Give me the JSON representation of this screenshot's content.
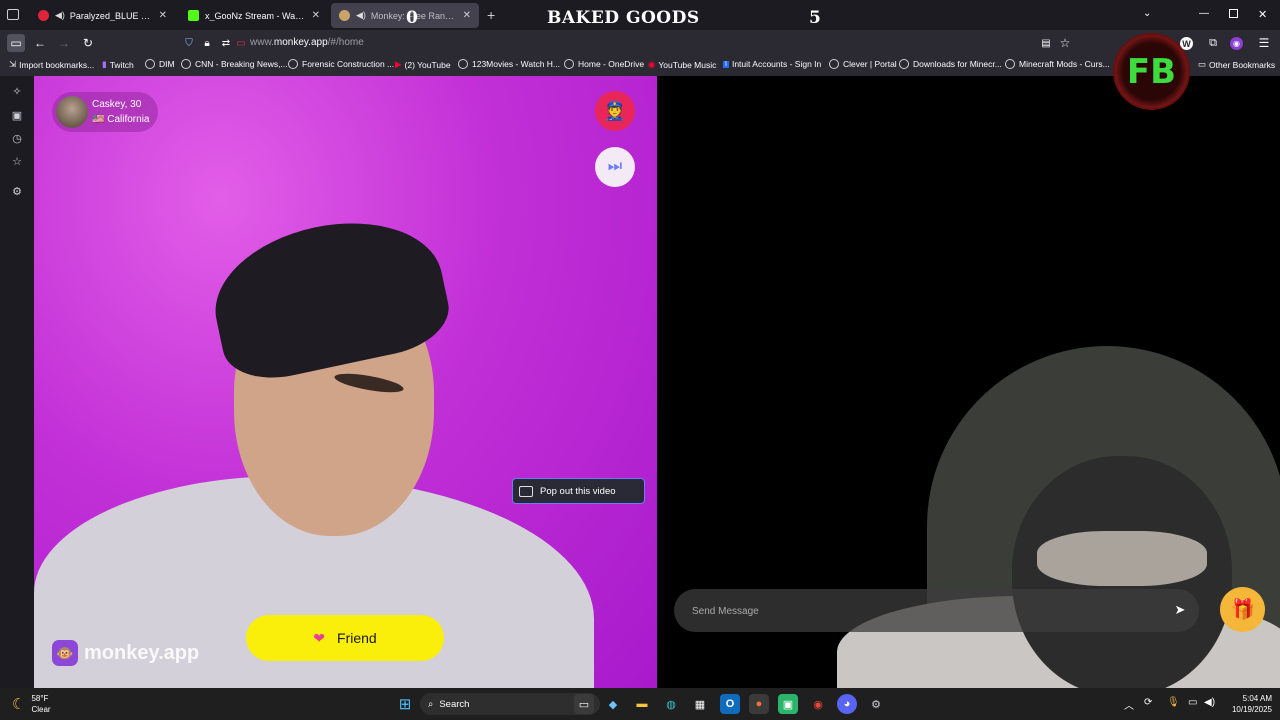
{
  "tabs": [
    {
      "title": "Paralyzed_BLUE - Explore y",
      "favicon_color": "#e0243a",
      "sound": true
    },
    {
      "title": "x_GooNz Stream - Watch Live o",
      "favicon_color": "#53fc18",
      "sound": false
    },
    {
      "title": "Monkey: Free Random Vide",
      "favicon_color": "#c9a46a",
      "sound": true,
      "active": true
    }
  ],
  "overlay": {
    "title": "BAKED GOODS",
    "left_number": "0",
    "right_number": "5"
  },
  "nav": {
    "url_prefix": "www.",
    "url_domain": "monkey.app",
    "url_path": "/#/home"
  },
  "bookmarks": [
    "Import bookmarks...",
    "Twitch",
    "DIM",
    "CNN - Breaking News,...",
    "Forensic Construction ...",
    "(2) YouTube",
    "123Movies - Watch H...",
    "Home - OneDrive",
    "YouTube Music",
    "Intuit Accounts - Sign In",
    "Clever | Portal",
    "Downloads for Minecr...",
    "Minecraft Mods - Curs...",
    "Other Bookmarks"
  ],
  "peer": {
    "name": "Caskey, 30",
    "location": "California",
    "flag": "🇺🇸"
  },
  "popout_label": "Pop out this video",
  "friend_label": "Friend",
  "brand_label": "monkey.app",
  "message": {
    "placeholder": "Send Message"
  },
  "stream_logo": "FB",
  "taskbar": {
    "weather_temp": "58°F",
    "weather_desc": "Clear",
    "search_label": "Search",
    "time": "5:04 AM",
    "date": "10/19/2025"
  },
  "colors": {
    "friend_button": "#f9ef0a",
    "video_bg": "#c12fd6",
    "accent": "#6a7cff"
  }
}
